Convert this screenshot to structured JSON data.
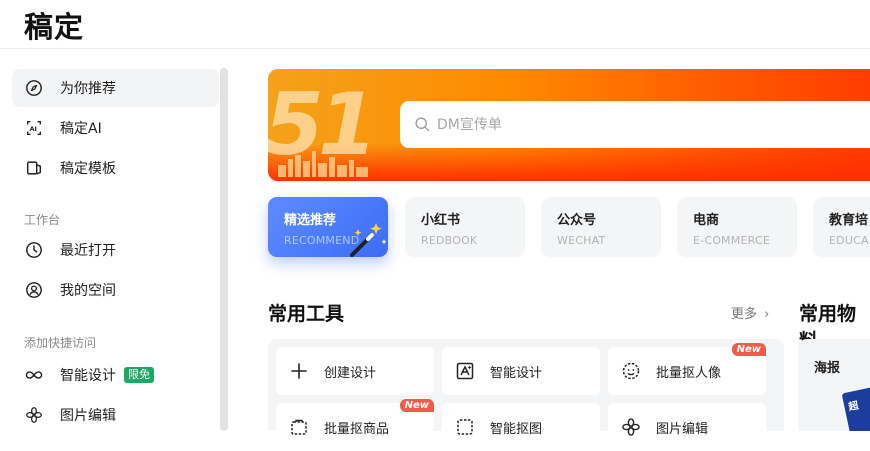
{
  "app": {
    "logo": "稿定"
  },
  "sidebar": {
    "items": [
      {
        "label": "为你推荐",
        "icon": "compass-icon",
        "active": true
      },
      {
        "label": "稿定AI",
        "icon": "ai-icon"
      },
      {
        "label": "稿定模板",
        "icon": "template-icon"
      }
    ],
    "workspace_label": "工作台",
    "workspace_items": [
      {
        "label": "最近打开",
        "icon": "clock-icon"
      },
      {
        "label": "我的空间",
        "icon": "user-circle-icon"
      }
    ],
    "quick_label": "添加快捷访问",
    "quick_items": [
      {
        "label": "智能设计",
        "icon": "infinity-icon",
        "badge": "限免"
      },
      {
        "label": "图片编辑",
        "icon": "flower-icon"
      }
    ]
  },
  "search": {
    "placeholder": "DM宣传单"
  },
  "categories": [
    {
      "title": "精选推荐",
      "subtitle": "RECOMMEND",
      "active": true
    },
    {
      "title": "小红书",
      "subtitle": "REDBOOK"
    },
    {
      "title": "公众号",
      "subtitle": "WECHAT"
    },
    {
      "title": "电商",
      "subtitle": "E-COMMERCE"
    },
    {
      "title": "教育培",
      "subtitle": "EDUCA"
    }
  ],
  "tools_section": {
    "title": "常用工具",
    "more": "更多",
    "tools": [
      {
        "label": "创建设计",
        "icon": "plus-icon"
      },
      {
        "label": "智能设计",
        "icon": "smart-design-icon"
      },
      {
        "label": "批量抠人像",
        "icon": "portrait-cutout-icon",
        "badge": "New"
      },
      {
        "label": "批量抠商品",
        "icon": "product-cutout-icon",
        "badge": "New"
      },
      {
        "label": "智能抠图",
        "icon": "cutout-icon"
      },
      {
        "label": "图片编辑",
        "icon": "flower-icon"
      }
    ]
  },
  "materials_section": {
    "title": "常用物料",
    "first_item": "海报",
    "thumb_text": "超"
  },
  "colors": {
    "accent": "#3c6cf5",
    "banner": "#ff6a00",
    "free_badge": "#1aa863",
    "new_badge": "#f25a4a"
  }
}
